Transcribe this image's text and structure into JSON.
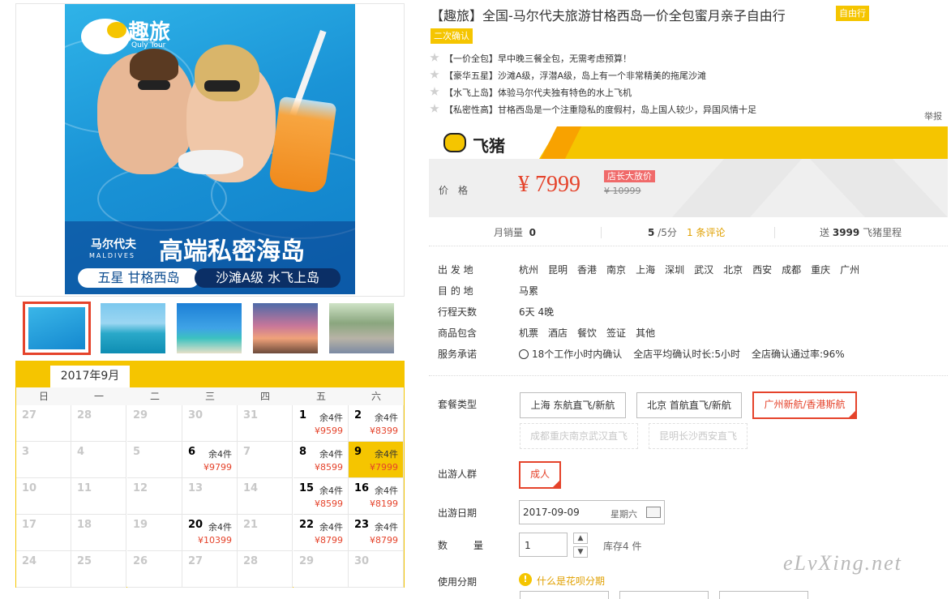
{
  "hero": {
    "logo": "趣旅",
    "logo_sub": "Quly Tour",
    "dest_cn": "马尔代夫",
    "dest_en": "MALDIVES",
    "headline": "高端私密海岛",
    "pill_left": "五星 甘格西岛",
    "pill_right": "沙滩A级 水飞上岛"
  },
  "thumbnails": [
    {
      "name": "couple-pool",
      "active": true
    },
    {
      "name": "overwater-villas",
      "active": false
    },
    {
      "name": "island-beach",
      "active": false
    },
    {
      "name": "sunset-deck",
      "active": false
    },
    {
      "name": "resort-walkway",
      "active": false
    }
  ],
  "calendar": {
    "month": "2017年9月",
    "weekdays": [
      "日",
      "一",
      "二",
      "三",
      "四",
      "五",
      "六"
    ],
    "weeks": [
      [
        {
          "d": "27"
        },
        {
          "d": "28"
        },
        {
          "d": "29"
        },
        {
          "d": "30"
        },
        {
          "d": "31"
        },
        {
          "d": "1",
          "stock": "余4件",
          "price": "¥9599"
        },
        {
          "d": "2",
          "stock": "余4件",
          "price": "¥8399"
        }
      ],
      [
        {
          "d": "3"
        },
        {
          "d": "4"
        },
        {
          "d": "5"
        },
        {
          "d": "6",
          "stock": "余4件",
          "price": "¥9799"
        },
        {
          "d": "7"
        },
        {
          "d": "8",
          "stock": "余4件",
          "price": "¥8599"
        },
        {
          "d": "9",
          "stock": "余4件",
          "price": "¥7999",
          "selected": true
        }
      ],
      [
        {
          "d": "10"
        },
        {
          "d": "11"
        },
        {
          "d": "12"
        },
        {
          "d": "13"
        },
        {
          "d": "14"
        },
        {
          "d": "15",
          "stock": "余4件",
          "price": "¥8599"
        },
        {
          "d": "16",
          "stock": "余4件",
          "price": "¥8199"
        }
      ],
      [
        {
          "d": "17"
        },
        {
          "d": "18"
        },
        {
          "d": "19"
        },
        {
          "d": "20",
          "stock": "余4件",
          "price": "¥10399"
        },
        {
          "d": "21"
        },
        {
          "d": "22",
          "stock": "余4件",
          "price": "¥8799"
        },
        {
          "d": "23",
          "stock": "余4件",
          "price": "¥8799"
        }
      ],
      [
        {
          "d": "24"
        },
        {
          "d": "25"
        },
        {
          "d": "26"
        },
        {
          "d": "27"
        },
        {
          "d": "28"
        },
        {
          "d": "29"
        },
        {
          "d": "30"
        }
      ]
    ]
  },
  "product": {
    "title": "【趣旅】全国-马尔代夫旅游甘格西岛一价全包蜜月亲子自由行",
    "tag_free": "自由行",
    "tag_confirm": "二次确认",
    "features": [
      "【一价全包】早中晚三餐全包，无需考虑预算！",
      "【豪华五星】沙滩A级，浮潜A级，岛上有一个非常精美的拖尾沙滩",
      "【水飞上岛】体验马尔代夫独有特色的水上飞机",
      "【私密性高】甘格西岛是一个注重隐私的度假村，岛上国人较少，异国风情十足"
    ],
    "report": "举报"
  },
  "brand": {
    "name": "飞猪"
  },
  "price": {
    "label": "价格",
    "current": "¥ 7999",
    "promo_tag": "店长大放价",
    "original": "¥ 10999"
  },
  "stats": {
    "monthly_sales_label": "月销量",
    "monthly_sales": "0",
    "rating": "5",
    "rating_suffix": "/5分",
    "reviews": "1 条评论",
    "miles_prefix": "送",
    "miles": "3999",
    "miles_suffix": "飞猪里程"
  },
  "details": {
    "depart_label": "出 发 地",
    "depart_cities": [
      "杭州",
      "昆明",
      "香港",
      "南京",
      "上海",
      "深圳",
      "武汉",
      "北京",
      "西安",
      "成都",
      "重庆",
      "广州"
    ],
    "dest_label": "目 的 地",
    "dest": "马累",
    "days_label": "行程天数",
    "days": "6天 4晚",
    "includes_label": "商品包含",
    "includes": [
      "机票",
      "酒店",
      "餐饮",
      "签证",
      "其他"
    ],
    "service_label": "服务承诺",
    "service": [
      "18个工作小时内确认",
      "全店平均确认时长:5小时",
      "全店确认通过率:96%"
    ]
  },
  "options": {
    "package_label": "套餐类型",
    "packages": [
      "上海 东航直飞/新航",
      "北京 首航直飞/新航",
      "广州新航/香港斯航",
      "成都重庆南京武汉直飞",
      "昆明长沙西安直飞"
    ],
    "people_label": "出游人群",
    "people": "成人",
    "date_label": "出游日期",
    "date": "2017-09-09",
    "weekday": "星期六",
    "qty_label": "数　量",
    "qty": "1",
    "stock": "库存4 件",
    "installment_label": "使用分期",
    "installment_link": "什么是花呗分期"
  },
  "watermark": "eLvXing.net"
}
